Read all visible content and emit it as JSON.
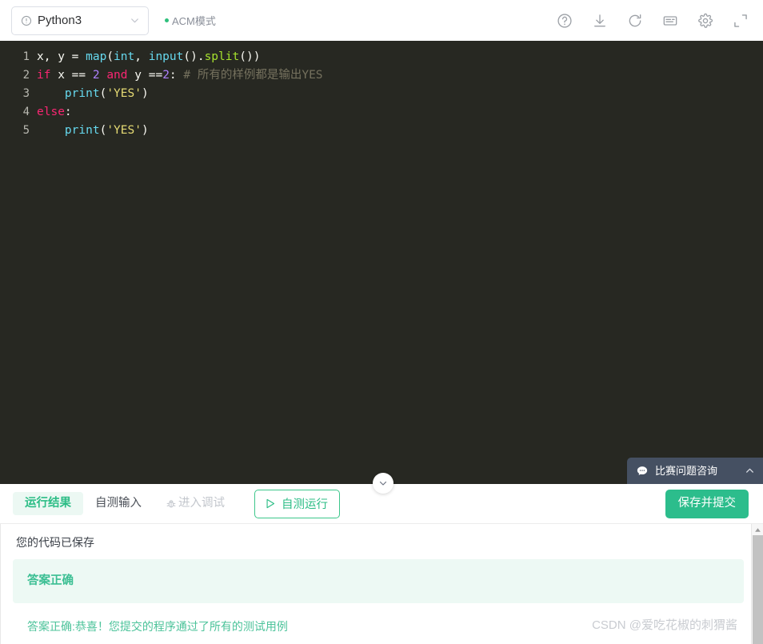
{
  "header": {
    "language_selector": {
      "value": "Python3",
      "info_icon": "info-circle-icon",
      "chevron_icon": "chevron-down-icon"
    },
    "mode_badge": "ACM模式",
    "mode_dot_color": "#2ec07c",
    "icons": [
      {
        "name": "help-icon",
        "title": "帮助"
      },
      {
        "name": "download-icon",
        "title": "下载"
      },
      {
        "name": "reset-icon",
        "title": "重置"
      },
      {
        "name": "note-icon",
        "title": "笔记"
      },
      {
        "name": "settings-gear-icon",
        "title": "设置"
      },
      {
        "name": "fullscreen-icon",
        "title": "全屏"
      }
    ]
  },
  "editor": {
    "background": "#272822",
    "language": "python",
    "lines": [
      {
        "number": "1",
        "tokens": [
          {
            "t": "x, y = ",
            "c": "plain"
          },
          {
            "t": "map",
            "c": "fn"
          },
          {
            "t": "(",
            "c": "plain"
          },
          {
            "t": "int",
            "c": "fn"
          },
          {
            "t": ", ",
            "c": "plain"
          },
          {
            "t": "input",
            "c": "fn"
          },
          {
            "t": "().",
            "c": "plain"
          },
          {
            "t": "split",
            "c": "method"
          },
          {
            "t": "())",
            "c": "plain"
          }
        ]
      },
      {
        "number": "2",
        "tokens": [
          {
            "t": "if",
            "c": "kw"
          },
          {
            "t": " x == ",
            "c": "plain"
          },
          {
            "t": "2",
            "c": "num"
          },
          {
            "t": " ",
            "c": "plain"
          },
          {
            "t": "and",
            "c": "kw"
          },
          {
            "t": " y ==",
            "c": "plain"
          },
          {
            "t": "2",
            "c": "num"
          },
          {
            "t": ": ",
            "c": "plain"
          },
          {
            "t": "# 所有的样例都是输出YES",
            "c": "comment"
          }
        ]
      },
      {
        "number": "3",
        "tokens": [
          {
            "t": "    ",
            "c": "plain"
          },
          {
            "t": "print",
            "c": "fn"
          },
          {
            "t": "(",
            "c": "plain"
          },
          {
            "t": "'YES'",
            "c": "str"
          },
          {
            "t": ")",
            "c": "plain"
          }
        ]
      },
      {
        "number": "4",
        "tokens": [
          {
            "t": "else",
            "c": "kw"
          },
          {
            "t": ":",
            "c": "plain"
          }
        ]
      },
      {
        "number": "5",
        "tokens": [
          {
            "t": "    ",
            "c": "plain"
          },
          {
            "t": "print",
            "c": "fn"
          },
          {
            "t": "(",
            "c": "plain"
          },
          {
            "t": "'YES'",
            "c": "str"
          },
          {
            "t": ")",
            "c": "plain"
          }
        ]
      }
    ]
  },
  "collapse_handle": {
    "icon": "chevron-down-icon"
  },
  "chat_widget": {
    "label": "比赛问题咨询",
    "bubble_icon": "chat-bubble-icon",
    "chevron_icon": "chevron-up-icon",
    "background": "#455062"
  },
  "bottom_panel": {
    "tabs": [
      {
        "label": "运行结果",
        "active": true,
        "disabled": false
      },
      {
        "label": "自测输入",
        "active": false,
        "disabled": false
      },
      {
        "label": "进入调试",
        "active": false,
        "disabled": true,
        "icon": "bug-icon"
      }
    ],
    "run_button": {
      "label": "自测运行",
      "icon": "play-icon"
    },
    "submit_button": {
      "label": "保存并提交"
    },
    "accent_color": "#2cbd86"
  },
  "results": {
    "saved_message": "您的代码已保存",
    "verdict_title": "答案正确",
    "verdict_detail": "答案正确:恭喜！您提交的程序通过了所有的测试用例",
    "verdict_color": "#3bbf93",
    "verdict_background": "#edf9f4"
  },
  "scrollbar": {
    "up_arrow_icon": "triangle-up-icon"
  },
  "watermark": "CSDN @爱吃花椒的刺猬酱"
}
